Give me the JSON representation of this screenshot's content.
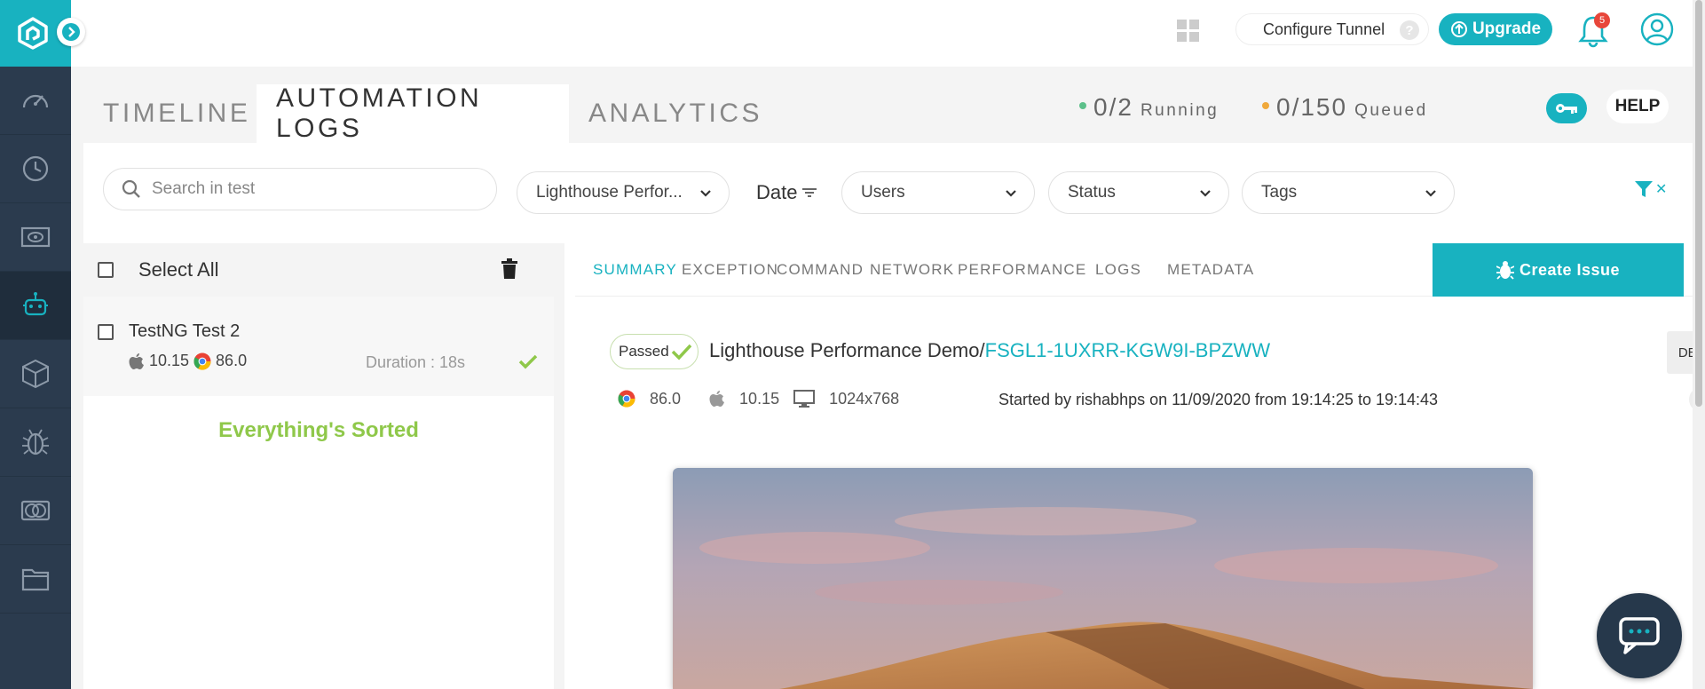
{
  "topbar": {
    "configure_tunnel": "Configure Tunnel",
    "help_q": "?",
    "upgrade": "Upgrade",
    "notification_count": "5"
  },
  "tabs": {
    "timeline": "TIMELINE",
    "automation_logs": "AUTOMATION LOGS",
    "analytics": "ANALYTICS"
  },
  "stats": {
    "running_count": "0/2",
    "running_label": "Running",
    "queued_count": "0/150",
    "queued_label": "Queued",
    "help": "HELP"
  },
  "filters": {
    "search_placeholder": "Search in test",
    "build": "Lighthouse Perfor...",
    "date": "Date",
    "users": "Users",
    "status": "Status",
    "tags": "Tags"
  },
  "list": {
    "select_all": "Select All",
    "tests": [
      {
        "name": "TestNG Test 2",
        "os_version": "10.15",
        "browser_version": "86.0",
        "duration": "Duration : 18s"
      }
    ],
    "empty_message": "Everything's Sorted"
  },
  "detail": {
    "tabs": [
      "SUMMARY",
      "EXCEPTION",
      "COMMAND",
      "NETWORK",
      "PERFORMANCE",
      "LOGS",
      "METADATA"
    ],
    "create_issue": "Create Issue",
    "status": "Passed",
    "build_name": "Lighthouse Performance Demo/",
    "test_id": "FSGL1-1UXRR-KGW9I-BPZWW",
    "delete": "DELETE",
    "browser_version": "86.0",
    "os_version": "10.15",
    "resolution": "1024x768",
    "started": "Started by rishabhps on 11/09/2020 from 19:14:25 to 19:14:43"
  },
  "colors": {
    "accent": "#18b2c0",
    "sidebar": "#2b3b4e",
    "running_dot": "#5cc08a",
    "queued_dot": "#f0a93b",
    "success": "#8fc84a"
  }
}
